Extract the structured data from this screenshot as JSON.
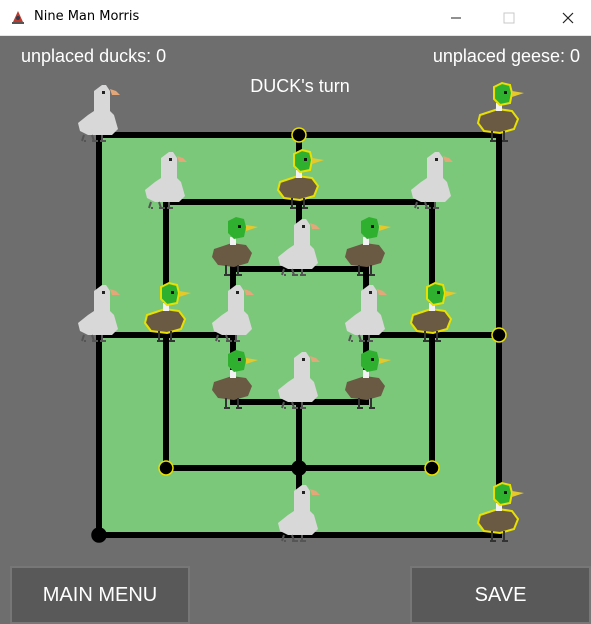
{
  "window": {
    "title": "Nine Man Morris"
  },
  "status": {
    "unplaced_ducks": "unplaced ducks: 0",
    "unplaced_geese": "unplaced geese: 0",
    "turn": "DUCK's turn"
  },
  "buttons": {
    "main_menu": "MAIN MENU",
    "save": "SAVE"
  },
  "colors": {
    "background": "#6e6e6e",
    "board": "#7bc87b",
    "line": "#000000"
  },
  "board": {
    "pieces": [
      {
        "pos": "a7",
        "type": "goose"
      },
      {
        "pos": "g7",
        "type": "duck",
        "highlight": true
      },
      {
        "pos": "b6",
        "type": "goose"
      },
      {
        "pos": "d6",
        "type": "duck",
        "highlight": true
      },
      {
        "pos": "f6",
        "type": "goose"
      },
      {
        "pos": "c5",
        "type": "duck"
      },
      {
        "pos": "d5",
        "type": "goose"
      },
      {
        "pos": "e5",
        "type": "duck"
      },
      {
        "pos": "a4",
        "type": "goose"
      },
      {
        "pos": "b4",
        "type": "duck",
        "highlight": true
      },
      {
        "pos": "c4",
        "type": "goose"
      },
      {
        "pos": "e4",
        "type": "goose"
      },
      {
        "pos": "f4",
        "type": "duck",
        "highlight": true
      },
      {
        "pos": "c3",
        "type": "duck"
      },
      {
        "pos": "d3",
        "type": "goose"
      },
      {
        "pos": "e3",
        "type": "duck"
      },
      {
        "pos": "d1",
        "type": "goose"
      },
      {
        "pos": "g1",
        "type": "duck",
        "highlight": true
      }
    ],
    "empty_points": [
      {
        "pos": "d7",
        "highlight": true
      },
      {
        "pos": "g4",
        "highlight": true
      },
      {
        "pos": "b2",
        "highlight": true
      },
      {
        "pos": "d2",
        "highlight": false
      },
      {
        "pos": "f2",
        "highlight": true
      },
      {
        "pos": "a1",
        "highlight": false
      }
    ]
  }
}
